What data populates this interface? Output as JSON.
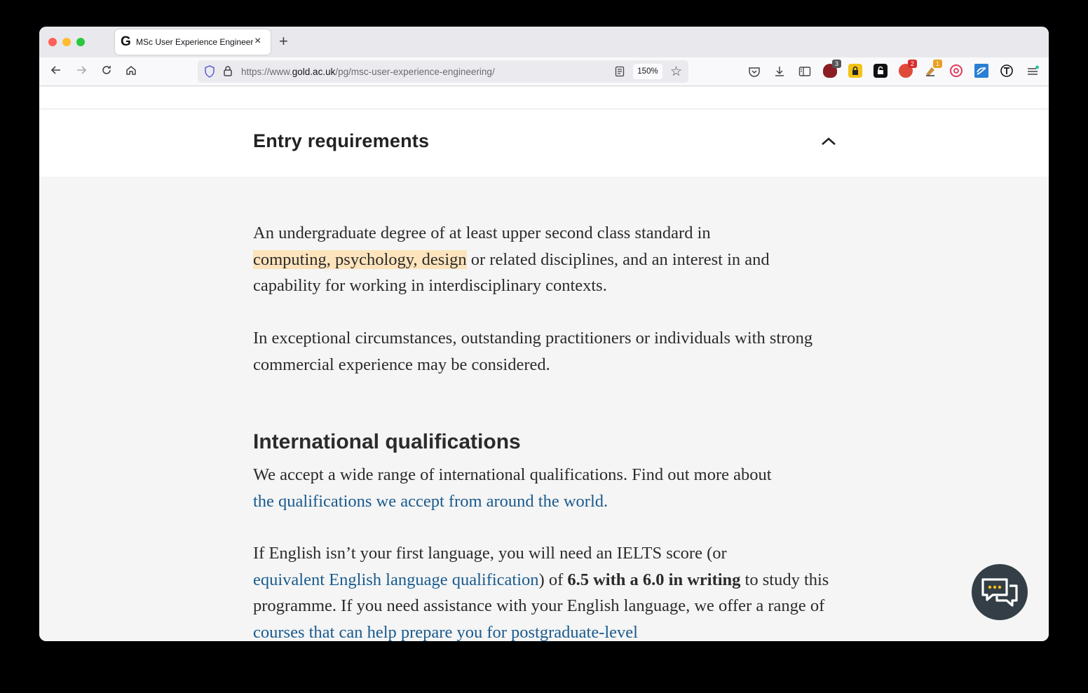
{
  "browser": {
    "tab_favicon": "G",
    "tab_title": "MSc User Experience Engineering",
    "tab_close": "×",
    "new_tab": "+",
    "url_prefix": "https://www.",
    "url_domain": "gold.ac.uk",
    "url_path": "/pg/msc-user-experience-engineering/",
    "zoom": "150%",
    "extension_badges": {
      "first": "3",
      "red": "2",
      "orange": "1"
    }
  },
  "accordion": {
    "title": "Entry requirements"
  },
  "entry": {
    "p1_a": "An undergraduate degree of at least upper second class standard in",
    "p1_highlight": "computing, psychology, design",
    "p1_b": " or related disciplines, and an interest in and capability for working in interdisciplinary contexts.",
    "p2": "In exceptional circumstances, outstanding practitioners or individuals with strong commercial experience may be considered."
  },
  "international": {
    "heading": "International qualifications",
    "p1": "We accept a wide range of international qualifications. Find out more about",
    "p1_link": "the qualifications we accept from around the world.",
    "p2_a": "If English isn’t your first language, you will need an IELTS score (or",
    "p2_link1": "equivalent English language qualification",
    "p2_b": ") of ",
    "p2_bold": "6.5 with a 6.0 in writing",
    "p2_c": " to study this programme. If you need assistance with your English language, we offer a range of ",
    "p2_link2": "courses that can help prepare you for postgraduate-level"
  },
  "colors": {
    "highlight": "#fde4bd",
    "link": "#1a5a8f",
    "chat_button": "#333e46"
  }
}
